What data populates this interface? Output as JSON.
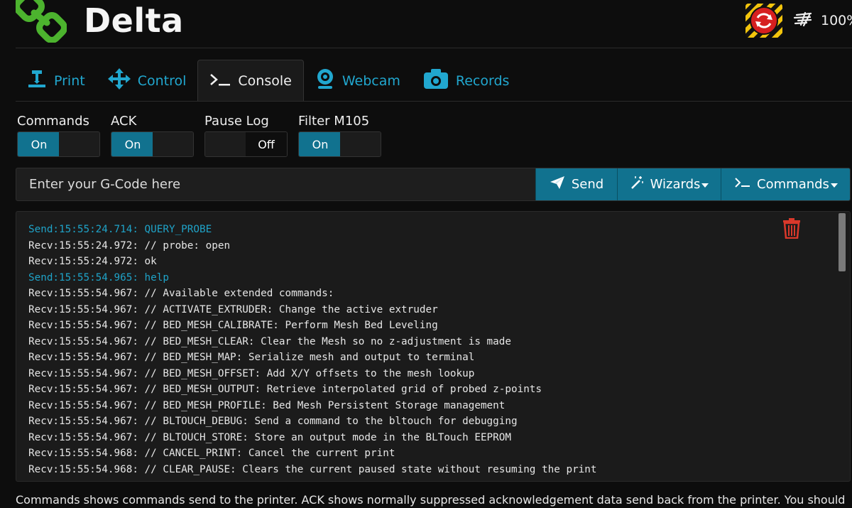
{
  "header": {
    "title": "Delta",
    "speed_text": "100%"
  },
  "tabs": [
    {
      "label": "Print"
    },
    {
      "label": "Control"
    },
    {
      "label": "Console"
    },
    {
      "label": "Webcam"
    },
    {
      "label": "Records"
    }
  ],
  "toggles": [
    {
      "label": "Commands",
      "state": "On"
    },
    {
      "label": "ACK",
      "state": "On"
    },
    {
      "label": "Pause Log",
      "state": "Off"
    },
    {
      "label": "Filter M105",
      "state": "On"
    }
  ],
  "command_bar": {
    "placeholder": "Enter your G-Code here",
    "send_label": "Send",
    "wizards_label": "Wizards",
    "commands_label": "Commands"
  },
  "log": [
    {
      "text": "Send:15:55:24.714: QUERY_PROBE",
      "type": "send"
    },
    {
      "text": "Recv:15:55:24.972: // probe: open",
      "type": "recv"
    },
    {
      "text": "Recv:15:55:24.972: ok",
      "type": "recv"
    },
    {
      "text": "Send:15:55:54.965: help",
      "type": "send"
    },
    {
      "text": "Recv:15:55:54.967: // Available extended commands:",
      "type": "recv"
    },
    {
      "text": "Recv:15:55:54.967: // ACTIVATE_EXTRUDER: Change the active extruder",
      "type": "recv"
    },
    {
      "text": "Recv:15:55:54.967: // BED_MESH_CALIBRATE: Perform Mesh Bed Leveling",
      "type": "recv"
    },
    {
      "text": "Recv:15:55:54.967: // BED_MESH_CLEAR: Clear the Mesh so no z-adjustment is made",
      "type": "recv"
    },
    {
      "text": "Recv:15:55:54.967: // BED_MESH_MAP: Serialize mesh and output to terminal",
      "type": "recv"
    },
    {
      "text": "Recv:15:55:54.967: // BED_MESH_OFFSET: Add X/Y offsets to the mesh lookup",
      "type": "recv"
    },
    {
      "text": "Recv:15:55:54.967: // BED_MESH_OUTPUT: Retrieve interpolated grid of probed z-points",
      "type": "recv"
    },
    {
      "text": "Recv:15:55:54.967: // BED_MESH_PROFILE: Bed Mesh Persistent Storage management",
      "type": "recv"
    },
    {
      "text": "Recv:15:55:54.967: // BLTOUCH_DEBUG: Send a command to the bltouch for debugging",
      "type": "recv"
    },
    {
      "text": "Recv:15:55:54.967: // BLTOUCH_STORE: Store an output mode in the BLTouch EEPROM",
      "type": "recv"
    },
    {
      "text": "Recv:15:55:54.968: // CANCEL_PRINT: Cancel the current print",
      "type": "recv"
    },
    {
      "text": "Recv:15:55:54.968: // CLEAR_PAUSE: Clears the current paused state without resuming the print",
      "type": "recv"
    }
  ],
  "help_text": "Commands shows commands send to the printer. ACK shows normally suppressed acknowledgement data send back from the printer. You should",
  "colors": {
    "accent": "#11728f",
    "link": "#21a7cf",
    "send_line": "#1fa3c8",
    "logo_green": "#4cb32e",
    "trash_red": "#d9382b"
  }
}
